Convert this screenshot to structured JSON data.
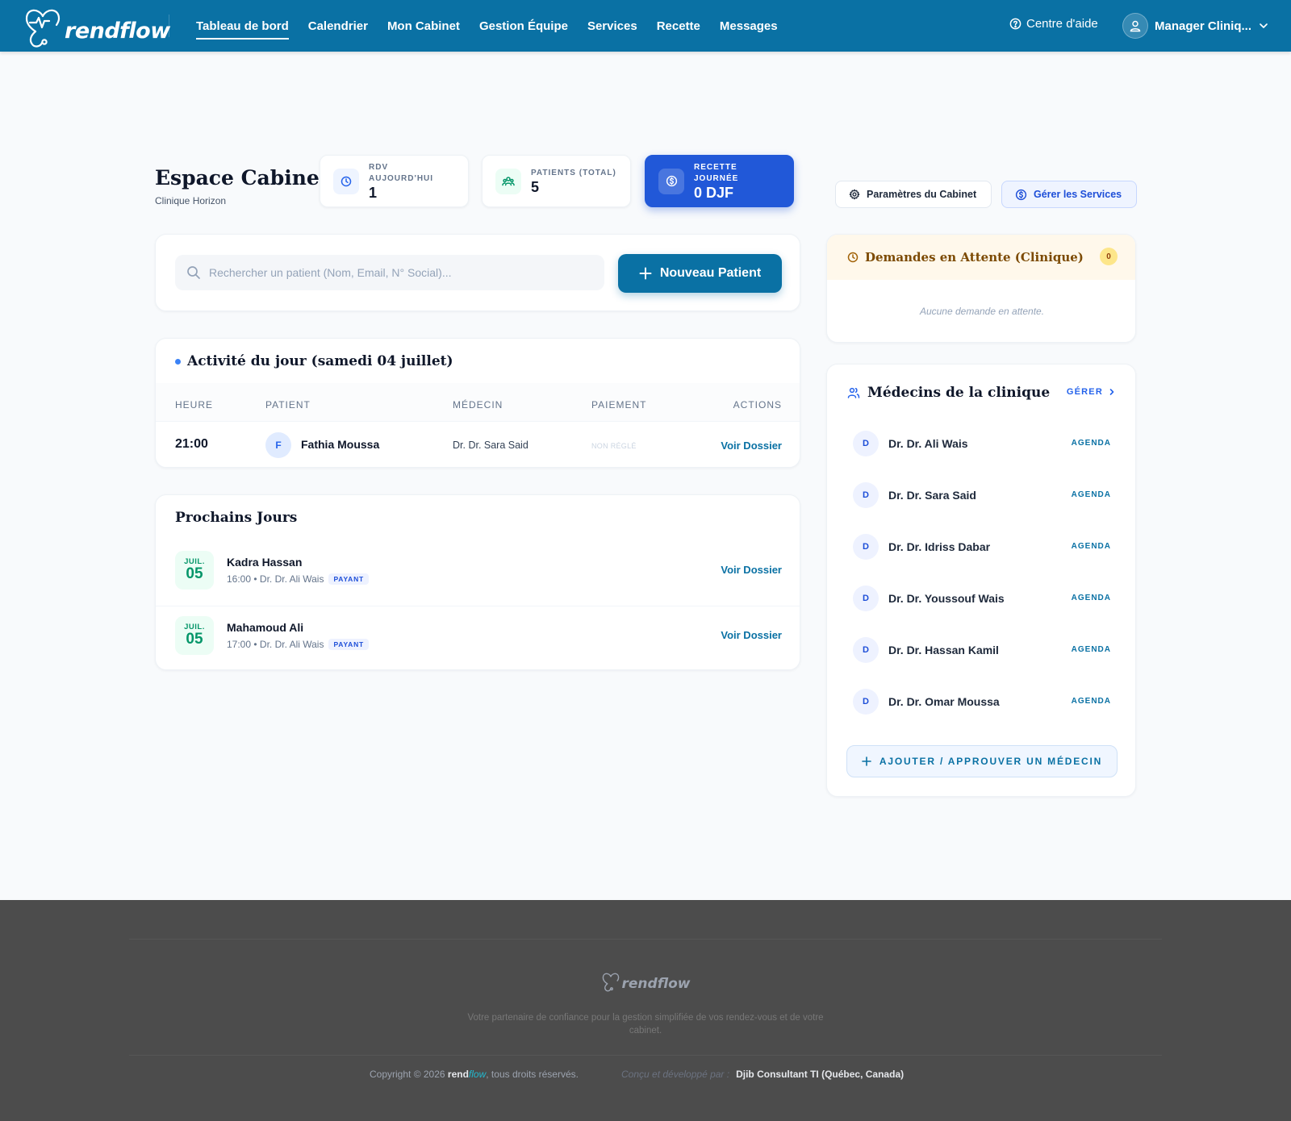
{
  "brand": {
    "name": "rendflow",
    "name_part1": "rend",
    "name_part2": "flow"
  },
  "nav": {
    "links": [
      {
        "label": "Tableau de bord",
        "active": true
      },
      {
        "label": "Calendrier"
      },
      {
        "label": "Mon Cabinet"
      },
      {
        "label": "Gestion Équipe"
      },
      {
        "label": "Services"
      },
      {
        "label": "Recette"
      },
      {
        "label": "Messages"
      }
    ],
    "help_label": "Centre d'aide",
    "user_label": "Manager Cliniq..."
  },
  "header": {
    "title": "Espace Cabinet",
    "subtitle": "Clinique Horizon"
  },
  "stats": [
    {
      "label_line1": "RDV",
      "label_line2": "AUJOURD'HUI",
      "value": "1"
    },
    {
      "label_line1": "PATIENTS (TOTAL)",
      "value": "5"
    },
    {
      "label_line1": "RECETTE",
      "label_line2": "JOURNÉE",
      "value": "0 DJF"
    }
  ],
  "actions": {
    "settings_label": "Paramètres du Cabinet",
    "services_label": "Gérer les Services"
  },
  "search": {
    "placeholder": "Rechercher un patient (Nom, Email, N° Social)...",
    "new_patient_label": "Nouveau Patient"
  },
  "activity": {
    "title": "Activité du jour (samedi 04 juillet)",
    "columns": [
      "HEURE",
      "PATIENT",
      "MÉDECIN",
      "PAIEMENT",
      "ACTIONS"
    ],
    "rows": [
      {
        "time": "21:00",
        "initial": "F",
        "patient": "Fathia Moussa",
        "doctor": "Dr. Dr. Sara Said",
        "payment": "NON RÉGLÉ",
        "action": "Voir Dossier"
      }
    ]
  },
  "upcoming": {
    "title": "Prochains Jours",
    "items": [
      {
        "month": "JUIL.",
        "day": "05",
        "name": "Kadra Hassan",
        "meta": "16:00 • Dr. Dr. Ali Wais",
        "badge": "PAYANT",
        "action": "Voir Dossier"
      },
      {
        "month": "JUIL.",
        "day": "05",
        "name": "Mahamoud Ali",
        "meta": "17:00 • Dr. Dr. Ali Wais",
        "badge": "PAYANT",
        "action": "Voir Dossier"
      }
    ]
  },
  "pending": {
    "title": "Demandes en Attente (Clinique)",
    "count": "0",
    "empty_text": "Aucune demande en attente."
  },
  "doctors": {
    "title": "Médecins de la clinique",
    "manage_label": "GÉRER",
    "agenda_label": "AGENDA",
    "items": [
      {
        "initial": "D",
        "name": "Dr. Dr. Ali Wais"
      },
      {
        "initial": "D",
        "name": "Dr. Dr. Sara Said"
      },
      {
        "initial": "D",
        "name": "Dr. Dr. Idriss Dabar"
      },
      {
        "initial": "D",
        "name": "Dr. Dr. Youssouf Wais"
      },
      {
        "initial": "D",
        "name": "Dr. Dr. Hassan Kamil"
      },
      {
        "initial": "D",
        "name": "Dr. Dr. Omar Moussa"
      }
    ],
    "add_label": "AJOUTER / APPROUVER UN MÉDECIN"
  },
  "footer": {
    "tagline": "Votre partenaire de confiance pour la gestion simplifiée de vos rendez-vous et de votre cabinet.",
    "copyright_prefix": "Copyright © 2026 ",
    "copyright_suffix": ", tous droits réservés.",
    "made_by_prefix": "Conçu et développé par :",
    "made_by": "Djib Consultant TI (Québec, Canada)"
  },
  "colors": {
    "primary": "#0a71a4",
    "accent_blue": "#2158d8",
    "green": "#059669",
    "footer_bg": "#4c4c4c"
  }
}
